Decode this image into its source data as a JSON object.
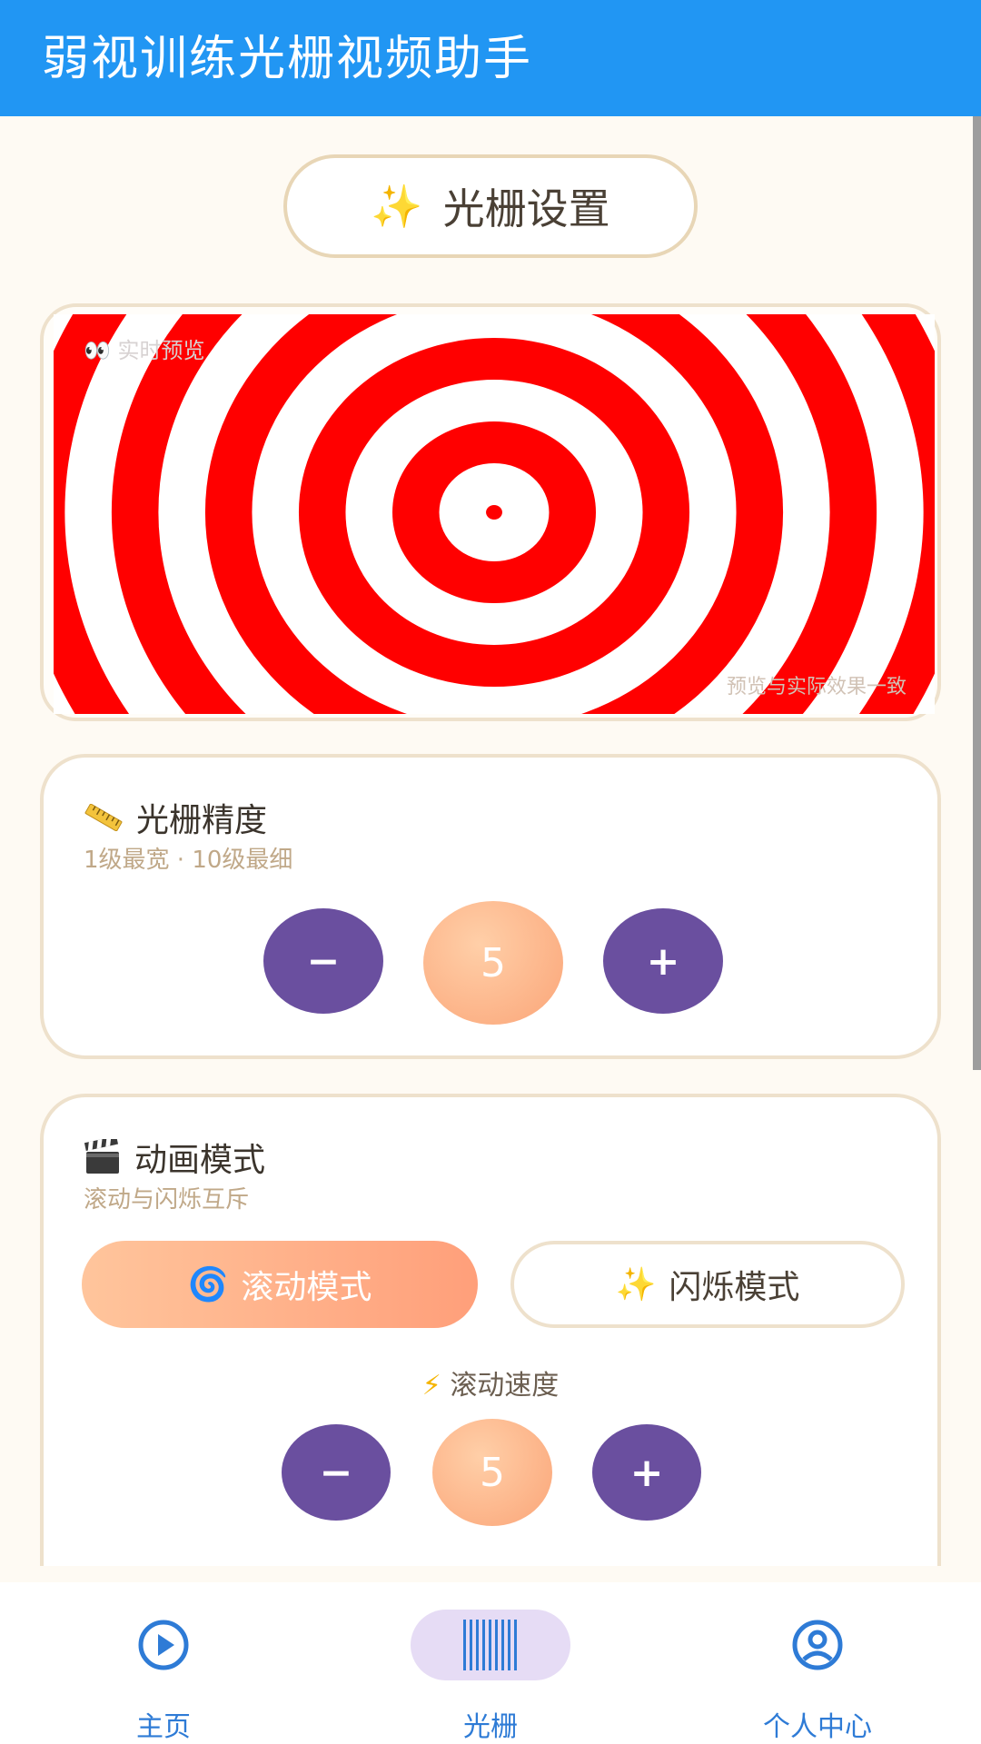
{
  "app_bar": {
    "title": "弱视训练光栅视频助手"
  },
  "settings_pill": {
    "label": "光栅设置"
  },
  "preview": {
    "label": "👀 实时预览",
    "note": "预览与实际效果一致",
    "colors": {
      "stripe": "#ff0000",
      "background": "#ffffff"
    }
  },
  "precision": {
    "title": "光栅精度",
    "subtitle": "1级最宽 · 10级最细",
    "minus": "−",
    "value": "5",
    "plus": "+"
  },
  "animation": {
    "title": "动画模式",
    "subtitle": "滚动与闪烁互斥",
    "modes": [
      {
        "icon": "🌀",
        "label": "滚动模式",
        "selected": true
      },
      {
        "icon": "✨",
        "label": "闪烁模式",
        "selected": false
      }
    ],
    "speed_label": "滚动速度",
    "speed_minus": "−",
    "speed_value": "5",
    "speed_plus": "+"
  },
  "bottom_nav": [
    {
      "label": "主页",
      "icon": "play-circle-icon",
      "active": false
    },
    {
      "label": "光栅",
      "icon": "grating-icon",
      "active": true
    },
    {
      "label": "个人中心",
      "icon": "account-circle-icon",
      "active": false
    }
  ],
  "colors": {
    "app_bar": "#2196f3",
    "accent_purple": "#6a4f9f",
    "accent_orange": "#fba578",
    "nav_blue": "#2e7bd6"
  }
}
